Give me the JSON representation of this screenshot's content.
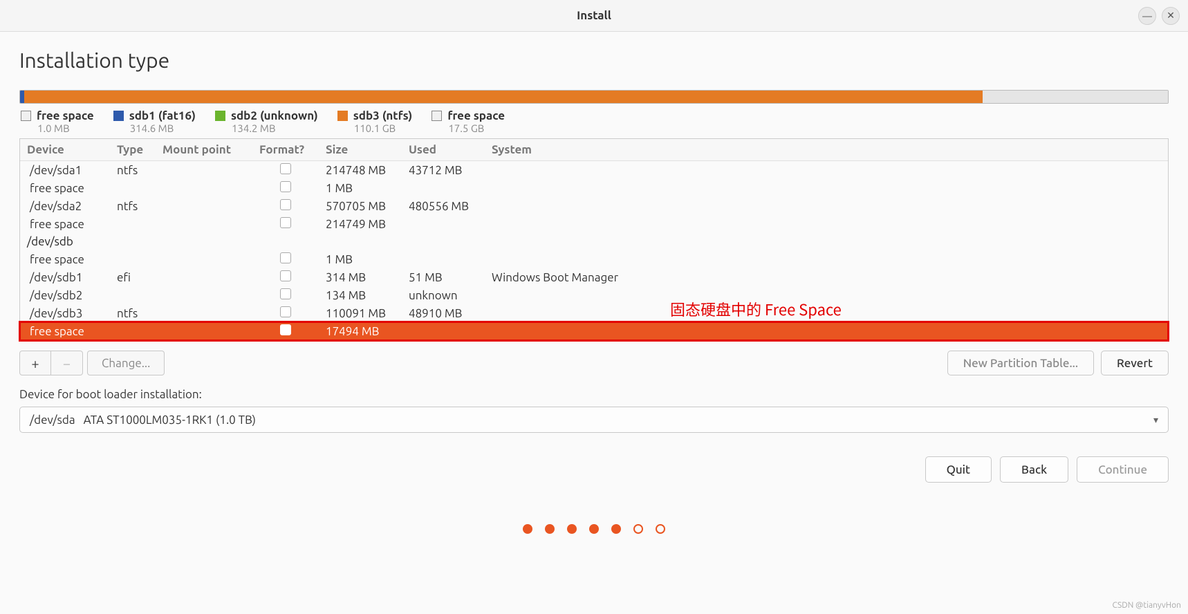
{
  "window": {
    "title": "Install"
  },
  "page": {
    "title": "Installation type"
  },
  "legend": [
    {
      "swatch": "free",
      "label": "free space",
      "sub": "1.0 MB"
    },
    {
      "swatch": "blue",
      "label": "sdb1 (fat16)",
      "sub": "314.6 MB"
    },
    {
      "swatch": "green",
      "label": "sdb2 (unknown)",
      "sub": "134.2 MB"
    },
    {
      "swatch": "orange",
      "label": "sdb3 (ntfs)",
      "sub": "110.1 GB"
    },
    {
      "swatch": "free",
      "label": "free space",
      "sub": "17.5 GB"
    }
  ],
  "columns": {
    "device": "Device",
    "type": "Type",
    "mount": "Mount point",
    "format": "Format?",
    "size": "Size",
    "used": "Used",
    "system": "System"
  },
  "rows": [
    {
      "device": "/dev/sda1",
      "indent": true,
      "type": "ntfs",
      "format": true,
      "size": "214748 MB",
      "used": "43712 MB",
      "system": ""
    },
    {
      "device": "free space",
      "indent": true,
      "type": "",
      "format": true,
      "size": "1 MB",
      "used": "",
      "system": ""
    },
    {
      "device": "/dev/sda2",
      "indent": true,
      "type": "ntfs",
      "format": true,
      "size": "570705 MB",
      "used": "480556 MB",
      "system": ""
    },
    {
      "device": "free space",
      "indent": true,
      "type": "",
      "format": true,
      "size": "214749 MB",
      "used": "",
      "system": ""
    },
    {
      "device": "/dev/sdb",
      "indent": false,
      "parent": true
    },
    {
      "device": "free space",
      "indent": true,
      "type": "",
      "format": true,
      "size": "1 MB",
      "used": "",
      "system": ""
    },
    {
      "device": "/dev/sdb1",
      "indent": true,
      "type": "efi",
      "format": true,
      "size": "314 MB",
      "used": "51 MB",
      "system": "Windows Boot Manager"
    },
    {
      "device": "/dev/sdb2",
      "indent": true,
      "type": "",
      "format": true,
      "size": "134 MB",
      "used": "unknown",
      "system": ""
    },
    {
      "device": "/dev/sdb3",
      "indent": true,
      "type": "ntfs",
      "format": true,
      "size": "110091 MB",
      "used": "48910 MB",
      "system": ""
    },
    {
      "device": "free space",
      "indent": true,
      "type": "",
      "format": true,
      "size": "17494 MB",
      "used": "",
      "system": "",
      "selected": true
    }
  ],
  "annotation": "固态硬盘中的 Free Space",
  "toolbar": {
    "add": "+",
    "remove": "−",
    "change": "Change...",
    "new_table": "New Partition Table...",
    "revert": "Revert"
  },
  "bootloader": {
    "label": "Device for boot loader installation:",
    "device": "/dev/sda",
    "desc": "ATA ST1000LM035-1RK1 (1.0 TB)"
  },
  "nav": {
    "quit": "Quit",
    "back": "Back",
    "continue": "Continue"
  },
  "watermark": "CSDN @tianyvHon"
}
